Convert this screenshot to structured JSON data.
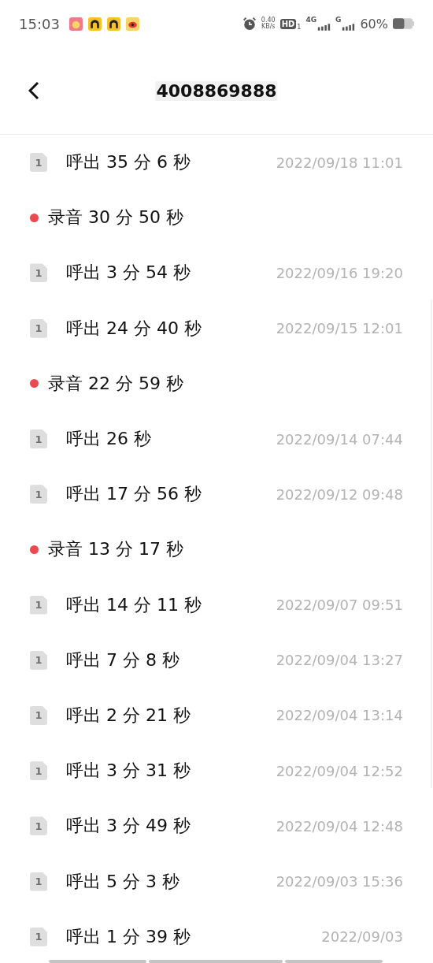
{
  "status_bar": {
    "time": "15:03",
    "speed_value": "0.40",
    "speed_unit": "KB/s",
    "hd": "HD",
    "hd_sim": "1",
    "network_1": "4G",
    "network_2": "G",
    "battery": "60%"
  },
  "header": {
    "title": "4008869888"
  },
  "records": [
    {
      "kind": "call",
      "sim": "1",
      "label": "呼出 35 分 6 秒",
      "date": "2022/09/18 11:01"
    },
    {
      "kind": "recording",
      "label": "录音 30 分 50 秒"
    },
    {
      "kind": "call",
      "sim": "1",
      "label": "呼出 3 分 54 秒",
      "date": "2022/09/16 19:20"
    },
    {
      "kind": "call",
      "sim": "1",
      "label": "呼出 24 分 40 秒",
      "date": "2022/09/15 12:01"
    },
    {
      "kind": "recording",
      "label": "录音 22 分 59 秒"
    },
    {
      "kind": "call",
      "sim": "1",
      "label": "呼出 26 秒",
      "date": "2022/09/14 07:44"
    },
    {
      "kind": "call",
      "sim": "1",
      "label": "呼出 17 分 56 秒",
      "date": "2022/09/12 09:48"
    },
    {
      "kind": "recording",
      "label": "录音 13 分 17 秒"
    },
    {
      "kind": "call",
      "sim": "1",
      "label": "呼出 14 分 11 秒",
      "date": "2022/09/07 09:51"
    },
    {
      "kind": "call",
      "sim": "1",
      "label": "呼出 7 分 8 秒",
      "date": "2022/09/04 13:27"
    },
    {
      "kind": "call",
      "sim": "1",
      "label": "呼出 2 分 21 秒",
      "date": "2022/09/04 13:14"
    },
    {
      "kind": "call",
      "sim": "1",
      "label": "呼出 3 分 31 秒",
      "date": "2022/09/04 12:52"
    },
    {
      "kind": "call",
      "sim": "1",
      "label": "呼出 3 分 49 秒",
      "date": "2022/09/04 12:48"
    },
    {
      "kind": "call",
      "sim": "1",
      "label": "呼出 5 分 3 秒",
      "date": "2022/09/03 15:36"
    },
    {
      "kind": "call",
      "sim": "1",
      "label": "呼出 1 分 39 秒",
      "date": "2022/09/03"
    }
  ]
}
